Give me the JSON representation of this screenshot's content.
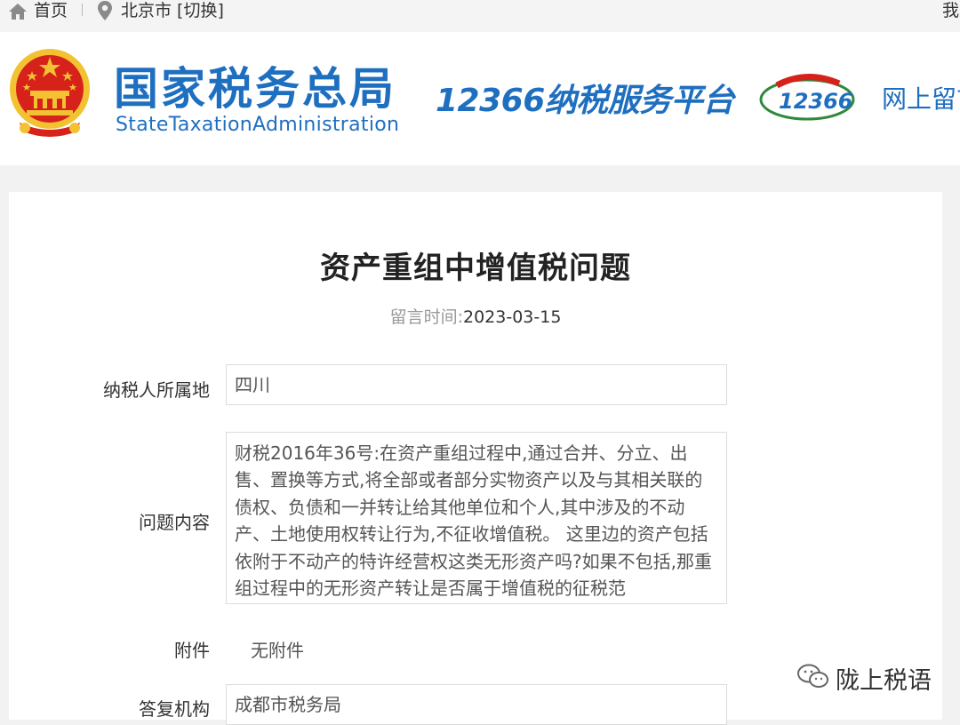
{
  "topbar": {
    "home_label": "首页",
    "city_label": "北京市 [切换]",
    "right_label": "我"
  },
  "header": {
    "brand_cn": "国家税务总局",
    "brand_en": "StateTaxationAdministration",
    "platform_title": "12366纳税服务平台",
    "message_link": "网上留言",
    "logo_text": "12366"
  },
  "message": {
    "title": "资产重组中增值税问题",
    "time_label": "留言时间:",
    "time_value": "2023-03-15",
    "location_label": "纳税人所属地",
    "location_value": "四川",
    "question_label": "问题内容",
    "question_value": "财税2016年36号:在资产重组过程中,通过合并、分立、出售、置换等方式,将全部或者部分实物资产以及与其相关联的债权、负债和一并转让给其他单位和个人,其中涉及的不动产、土地使用权转让行为,不征收增值税。 这里边的资产包括依附于不动产的特许经营权这类无形资产吗?如果不包括,那重组过程中的无形资产转让是否属于增值税的征税范",
    "attachment_label": "附件",
    "attachment_value": "无附件",
    "reply_org_label": "答复机构",
    "reply_org_value": "成都市税务局"
  },
  "watermark": {
    "text": "陇上税语"
  },
  "colors": {
    "brand_blue": "#1f6fc0",
    "emblem_red": "#d7221b",
    "emblem_gold": "#f2c232"
  }
}
